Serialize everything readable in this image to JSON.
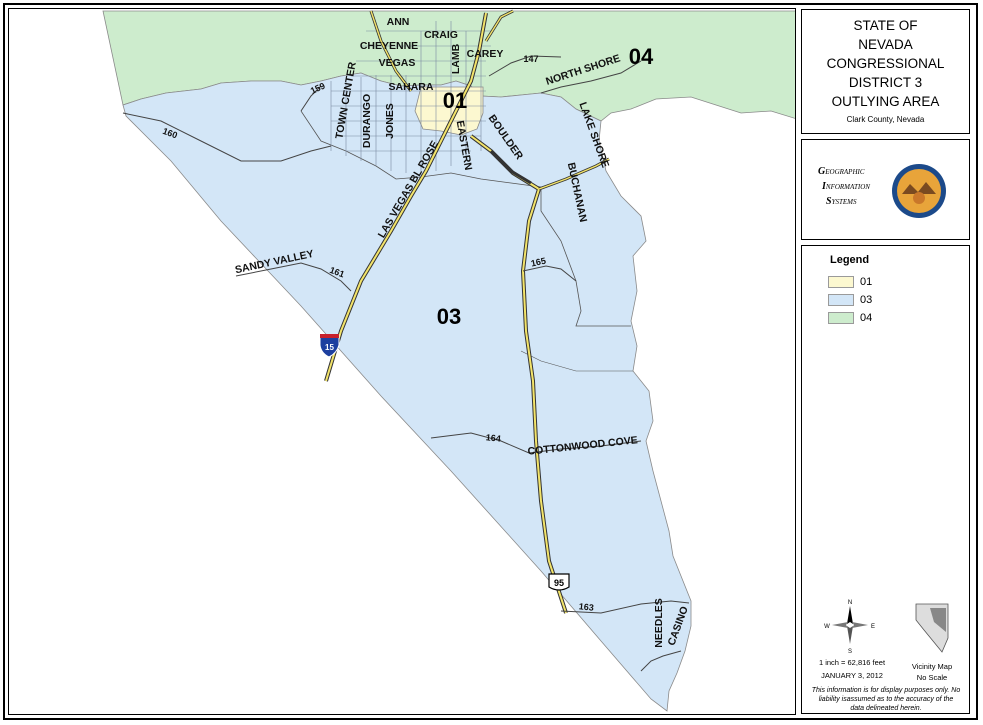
{
  "title": {
    "lines": [
      "STATE OF",
      "NEVADA",
      "CONGRESSIONAL",
      "DISTRICT 3",
      "OUTLYING AREA"
    ],
    "subtitle": "Clark County, Nevada"
  },
  "gis": {
    "line1_initial": "G",
    "line1_rest": "EOGRAPHIC",
    "line2_initial": "I",
    "line2_rest": "NFORMATION",
    "line3_initial": "S",
    "line3_rest": "YSTEMS"
  },
  "legend": {
    "title": "Legend",
    "items": [
      {
        "label": "01",
        "color": "#fcf8d0"
      },
      {
        "label": "03",
        "color": "#d3e6f7"
      },
      {
        "label": "04",
        "color": "#cdeccd"
      }
    ]
  },
  "scale_text": "1 inch = 62,816 feet",
  "date_text": "JANUARY 3, 2012",
  "vicinity": {
    "line1": "Vicinity Map",
    "line2": "No Scale"
  },
  "disclaimer": {
    "line1": "This information is for display purposes only. No",
    "line2": "liability isassumed as to the accuracy of the",
    "line3": "data delineated herein."
  },
  "north_arrow": {
    "n": "N",
    "s": "S",
    "e": "E",
    "w": "W"
  },
  "map": {
    "districts": {
      "d01": "01",
      "d03": "03",
      "d04": "04"
    },
    "streets": {
      "ann": "ANN",
      "craig": "CRAIG",
      "cheyenne": "CHEYENNE",
      "carey": "CAREY",
      "vegas": "VEGAS",
      "sahara": "SAHARA",
      "lamb": "LAMB",
      "town_center": "TOWN CENTER",
      "durango": "DURANGO",
      "jones": "JONES",
      "eastern": "EASTERN",
      "boulder": "BOULDER",
      "las_vegas_bl": "LAS VEGAS BL ROSE",
      "north_shore": "NORTH SHORE",
      "lake_shore": "LAKE SHORE",
      "buchanan": "BUCHANAN",
      "sandy_valley": "SANDY VALLEY",
      "cottonwood_cove": "COTTONWOOD COVE",
      "needles": "NEEDLES",
      "casino": "CASINO"
    },
    "routes": {
      "r147": "147",
      "r159": "159",
      "r160": "160",
      "r161": "161",
      "r165": "165",
      "r164": "164",
      "r163": "163",
      "i15": "15",
      "us95": "95"
    }
  }
}
